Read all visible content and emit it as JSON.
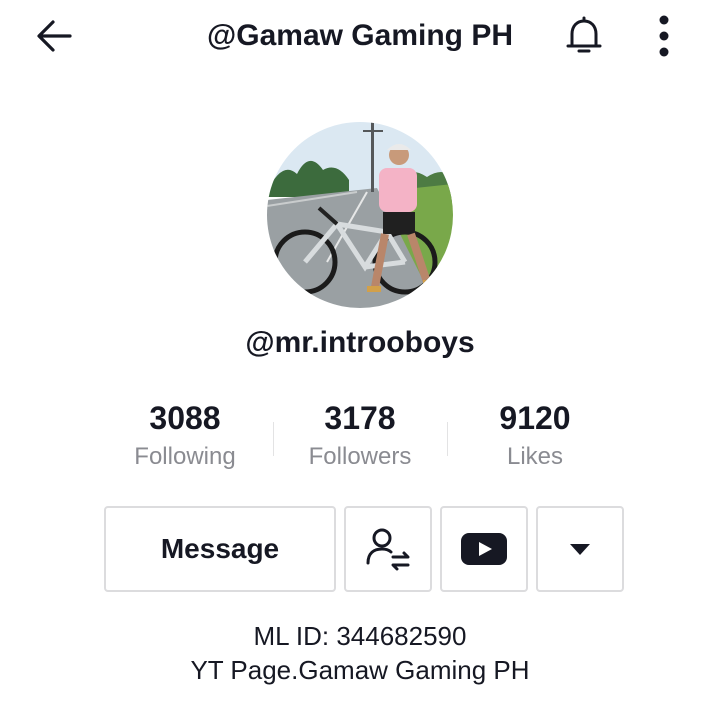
{
  "header": {
    "title": "@Gamaw Gaming PH",
    "icons": {
      "back": "back-arrow-icon",
      "bell": "bell-icon",
      "more": "more-vertical-icon"
    }
  },
  "profile": {
    "username": "@mr.introoboys",
    "avatar": "profile-photo-cyclist"
  },
  "stats": [
    {
      "value": "3088",
      "label": "Following"
    },
    {
      "value": "3178",
      "label": "Followers"
    },
    {
      "value": "9120",
      "label": "Likes"
    }
  ],
  "actions": {
    "message_label": "Message",
    "icons": {
      "friends": "add-friend-swap-icon",
      "youtube": "youtube-icon",
      "dropdown": "caret-down-icon"
    }
  },
  "bio": {
    "line1": "ML ID: 344682590",
    "line2": "YT Page.Gamaw Gaming PH"
  },
  "colors": {
    "text_primary": "#161823",
    "text_secondary": "#8a8b91",
    "border": "#dcdcde"
  }
}
